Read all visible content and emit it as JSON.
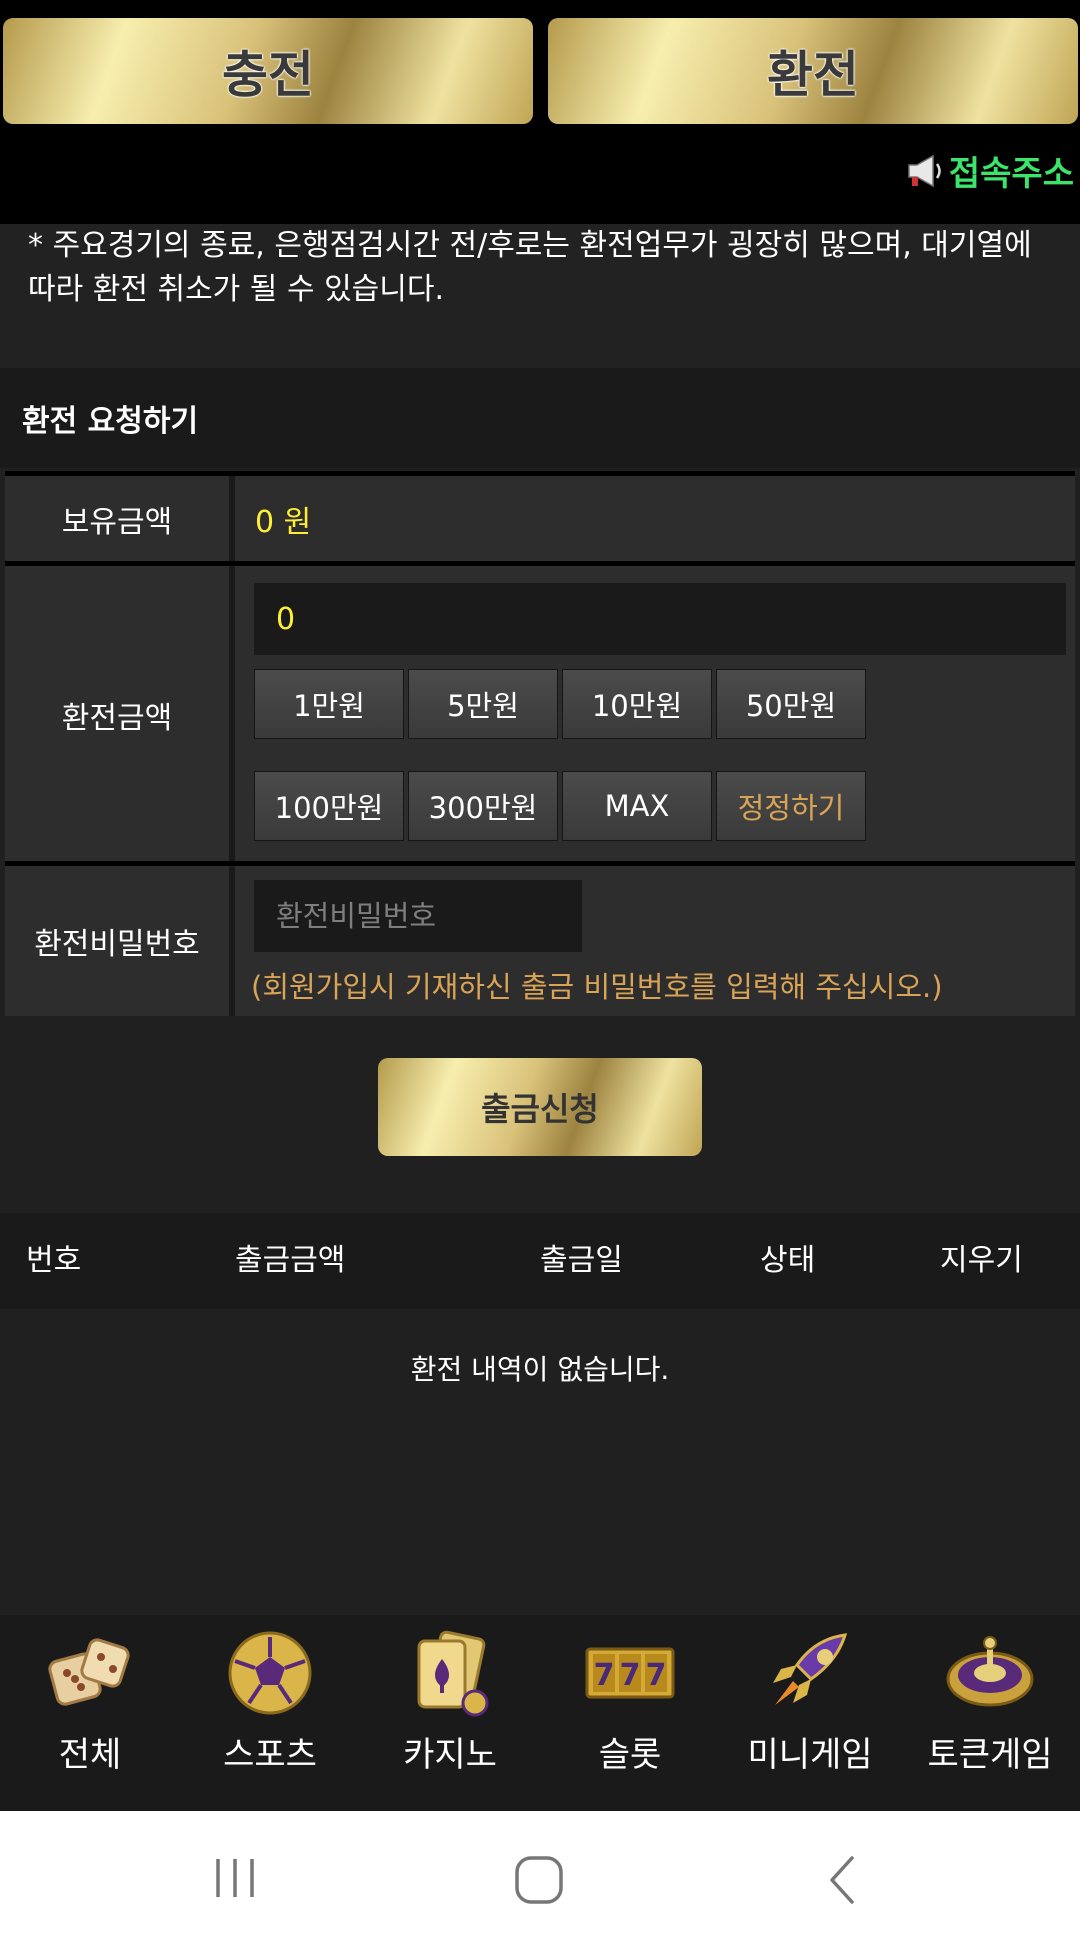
{
  "top": {
    "charge_label": "충전",
    "exchange_label": "환전",
    "access_label": "접속주소"
  },
  "notice": "* 주요경기의 종료, 은행점검시간 전/후로는 환전업무가 굉장히 많으며, 대기열에 따라 환전 취소가 될 수 있습니다.",
  "form": {
    "title": "환전 요청하기",
    "balance_label": "보유금액",
    "balance_value": "0 원",
    "amount_label": "환전금액",
    "amount_value": "0",
    "quick_buttons": [
      "1만원",
      "5만원",
      "10만원",
      "50만원",
      "100만원",
      "300만원",
      "MAX",
      "정정하기"
    ],
    "password_label": "환전비밀번호",
    "password_placeholder": "환전비밀번호",
    "password_hint": "(회원가입시 기재하신 출금 비밀번호를 입력해 주십시오.)",
    "submit_label": "출금신청"
  },
  "history": {
    "columns": [
      "번호",
      "출금금액",
      "출금일",
      "상태",
      "지우기"
    ],
    "empty_message": "환전 내역이 없습니다."
  },
  "bottom_nav": [
    {
      "label": "전체",
      "icon": "dice-icon"
    },
    {
      "label": "스포츠",
      "icon": "soccer-ball-icon"
    },
    {
      "label": "카지노",
      "icon": "playing-cards-icon"
    },
    {
      "label": "슬롯",
      "icon": "slot-777-icon"
    },
    {
      "label": "미니게임",
      "icon": "rocket-icon"
    },
    {
      "label": "토큰게임",
      "icon": "roulette-icon"
    }
  ],
  "colors": {
    "accent_gold": "#d9c27a",
    "balance_yellow": "#ffee36",
    "hint_orange": "#d9a457",
    "access_green": "#3de46b"
  }
}
